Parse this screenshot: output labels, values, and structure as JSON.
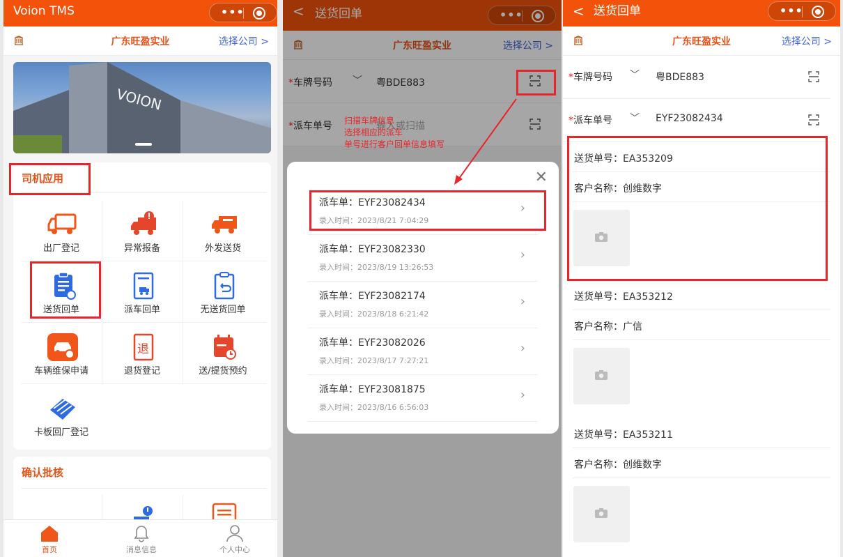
{
  "panel1": {
    "app_title": "Voion TMS",
    "company": "广东旺盈实业",
    "select_company": "选择公司 >",
    "driver_section": "司机应用",
    "driver_apps": [
      {
        "label": "出厂登记",
        "icon": "truck-icon"
      },
      {
        "label": "异常报备",
        "icon": "truck-alert-icon"
      },
      {
        "label": "外发送货",
        "icon": "delivery-truck-icon"
      },
      {
        "label": "送货回单",
        "icon": "clipboard-icon"
      },
      {
        "label": "派车回单",
        "icon": "dispatch-doc-icon"
      },
      {
        "label": "无送货回单",
        "icon": "return-doc-icon"
      },
      {
        "label": "车辆维保申请",
        "icon": "car-repair-icon"
      },
      {
        "label": "退货登记",
        "icon": "return-goods-icon"
      },
      {
        "label": "送/提货预约",
        "icon": "calendar-icon"
      },
      {
        "label": "卡板回厂登记",
        "icon": "pallet-icon"
      }
    ],
    "approve_section": "确认批核",
    "tabs": [
      "首页",
      "消息信息",
      "个人中心"
    ]
  },
  "panel2": {
    "title": "送货回单",
    "company": "广东旺盈实业",
    "select_company": "选择公司 >",
    "plate_label": "车牌号码",
    "plate_value": "粤BDE883",
    "dispatch_label": "派车单号",
    "dispatch_placeholder": "输入或扫描",
    "annotation": "扫描车牌信息\n选择相应的派车\n单号进行客户回单信息填写",
    "list": [
      {
        "no": "派车单：EYF23082434",
        "time": "录入时间：2023/8/21 7:04:29"
      },
      {
        "no": "派车单：EYF23082330",
        "time": "录入时间：2023/8/19 13:26:53"
      },
      {
        "no": "派车单：EYF23082174",
        "time": "录入时间：2023/8/18 6:21:42"
      },
      {
        "no": "派车单：EYF23082026",
        "time": "录入时间：2023/8/17 7:27:21"
      },
      {
        "no": "派车单：EYF23081875",
        "time": "录入时间：2023/8/16 6:56:03"
      }
    ]
  },
  "panel3": {
    "title": "送货回单",
    "company": "广东旺盈实业",
    "select_company": "选择公司 >",
    "plate_label": "车牌号码",
    "plate_value": "粤BDE883",
    "dispatch_label": "派车单号",
    "dispatch_value": "EYF23082434",
    "deliveries": [
      {
        "order": "送货单号：EA353209",
        "customer": "客户名称：创维数字"
      },
      {
        "order": "送货单号：EA353212",
        "customer": "客户名称：广信"
      },
      {
        "order": "送货单号：EA353211",
        "customer": "客户名称：创维数字"
      }
    ]
  },
  "colors": {
    "brand": "#f2520a",
    "accent_text": "#e2531a",
    "highlight": "#e8252b",
    "link": "#3e63d6"
  }
}
